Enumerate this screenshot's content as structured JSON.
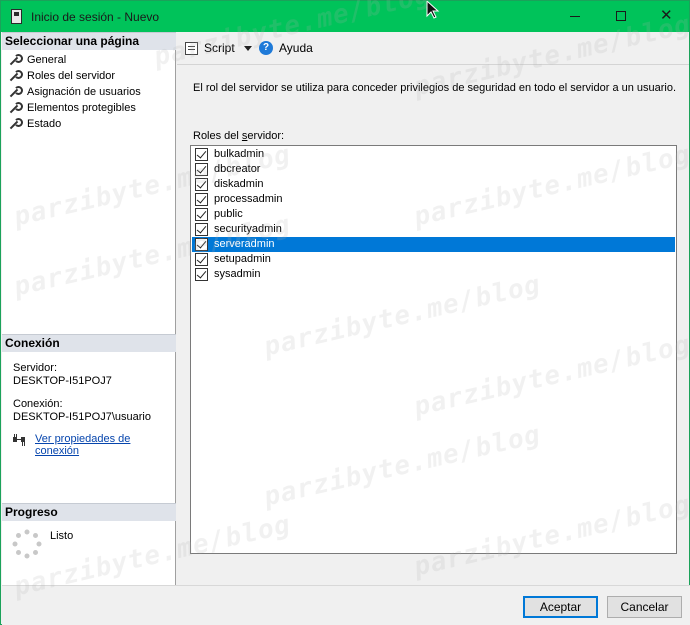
{
  "window": {
    "title": "Inicio de sesión - Nuevo",
    "accent_color": "#00c35a"
  },
  "left_pane": {
    "select_page_header": "Seleccionar una página",
    "pages": [
      {
        "label": "General",
        "icon": "wrench-icon"
      },
      {
        "label": "Roles del servidor",
        "icon": "wrench-icon"
      },
      {
        "label": "Asignación de usuarios",
        "icon": "wrench-icon"
      },
      {
        "label": "Elementos protegibles",
        "icon": "wrench-icon"
      },
      {
        "label": "Estado",
        "icon": "wrench-icon"
      }
    ],
    "connection": {
      "header": "Conexión",
      "server_label": "Servidor:",
      "server_value": "DESKTOP-I51POJ7",
      "connection_label": "Conexión:",
      "connection_value": "DESKTOP-I51POJ7\\usuario",
      "link": "Ver propiedades de conexión"
    },
    "progress": {
      "header": "Progreso",
      "status": "Listo"
    }
  },
  "toolbar": {
    "script_label": "Script",
    "help_label": "Ayuda"
  },
  "content": {
    "description": "El rol del servidor se utiliza para conceder privilegios de seguridad en todo el servidor a un usuario.",
    "list_label_prefix": "Roles del ",
    "list_label_underlined": "s",
    "list_label_suffix": "ervidor:",
    "roles": [
      {
        "name": "bulkadmin",
        "checked": true
      },
      {
        "name": "dbcreator",
        "checked": true
      },
      {
        "name": "diskadmin",
        "checked": true
      },
      {
        "name": "processadmin",
        "checked": true
      },
      {
        "name": "public",
        "checked": true
      },
      {
        "name": "securityadmin",
        "checked": true
      },
      {
        "name": "serveradmin",
        "checked": true,
        "selected": true
      },
      {
        "name": "setupadmin",
        "checked": true
      },
      {
        "name": "sysadmin",
        "checked": true
      }
    ],
    "selection_color": "#0078d7"
  },
  "footer": {
    "ok_label": "Aceptar",
    "cancel_label": "Cancelar"
  },
  "watermark": {
    "text": "parzibyte.me/blog"
  }
}
